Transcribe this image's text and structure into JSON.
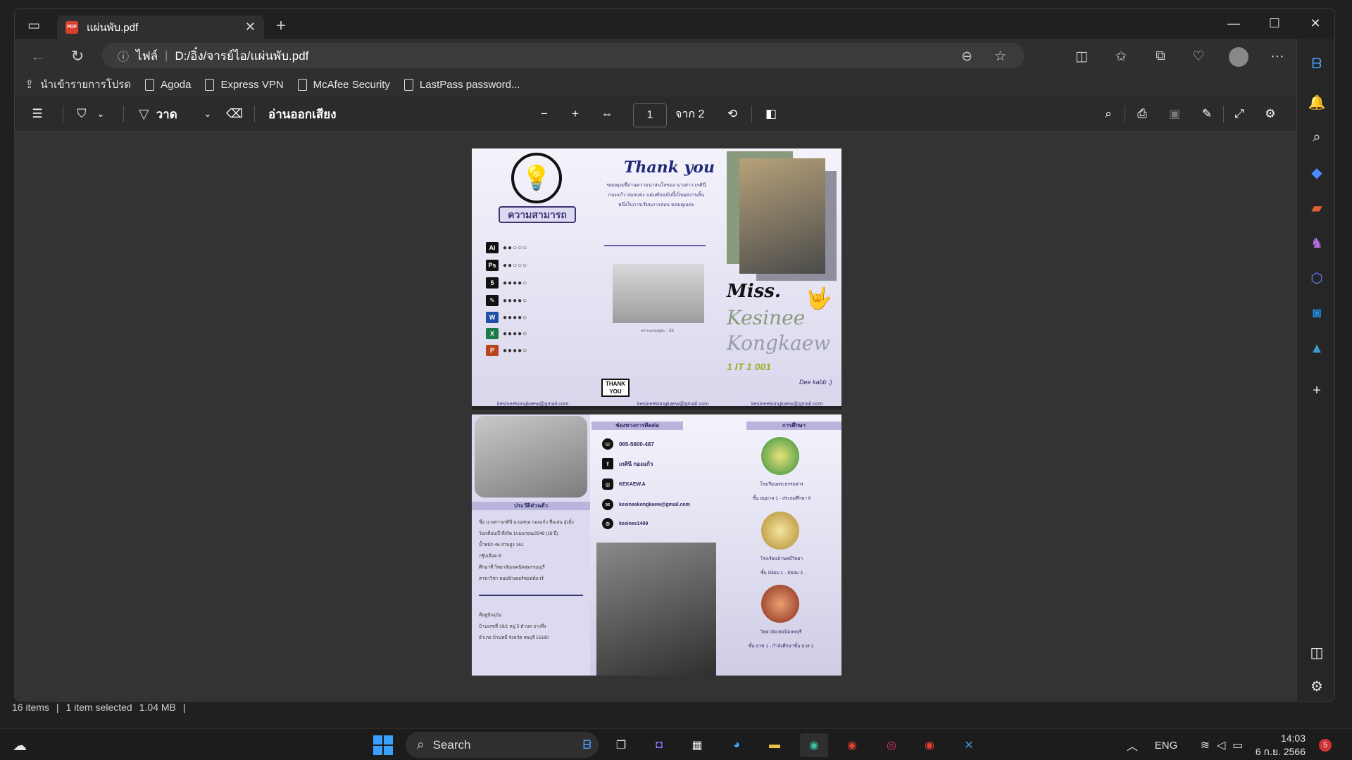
{
  "tab": {
    "title": "แผ่นพับ.pdf"
  },
  "address": {
    "scheme_label": "ไฟล์",
    "path": "D:/อิ๋ง/จารย์ไอ/แผ่นพับ.pdf"
  },
  "favorites": [
    {
      "label": "นำเข้ารายการโปรด"
    },
    {
      "label": "Agoda"
    },
    {
      "label": "Express VPN"
    },
    {
      "label": "McAfee Security"
    },
    {
      "label": "LastPass password..."
    }
  ],
  "pdf_toolbar": {
    "draw_label": "วาด",
    "read_aloud_label": "อ่านออกเสียง",
    "page_current": "1",
    "page_total_label": "จาก 2"
  },
  "page1": {
    "skills_title": "ความสามารถ",
    "skill_icons": [
      "Ai",
      "Ps",
      "5",
      "✎",
      "W",
      "X",
      "P"
    ],
    "thank_title": "Thank you",
    "thank_text": "ขอบคุณที่อ่านความน่าสนใจของ นางสาว เกศินี กองแก้ว จนจบค่ะ แผ่นพับฉบับนี้เป็นผลงานสิ้นหนึ่งในการเรียนการสอน ขอบคุณค่ะ",
    "photo_caption": "กราบงามๆค่ะ :-33",
    "sign_text": "THANK YOU",
    "name_prefix": "Miss.",
    "name_first": "Kesinee",
    "name_last": "Kongkaew",
    "class_code": "1 IT 1 001",
    "bye": "Dee kabb :)",
    "email": "kesineekongkaew@gmail.com"
  },
  "page2": {
    "bio_head": "ประวัติส่วนตัว",
    "bio_lines": [
      "ชื่อ นางสาวเกศินี นามสกุล กองแก้ว ชื่อเล่น อุ๋งอิ๋ง",
      "วัน/เดือน/ปี ที่เกิด 1/เมษายน/2548 (18 ปี)",
      "น้ำหนัก 46 ส่วนสูง 161",
      "กรุ๊ปเลือด B",
      "ศึกษาที่ วิทยาลัยเทคนิคสุพรรณบุรี",
      "สาขาวิชา คอมพิวเตอร์ซอฟต์แวร์"
    ],
    "address_lines": [
      "ที่อยู่ปัจจุบัน",
      "บ้านเลขที่ 16/1 หมู่ 5 ตำบล บางพึ่ง",
      "อำเภอ บ้านหมี่ จังหวัด ลพบุรี 15180"
    ],
    "contact_head": "ช่องทางการติดต่อ",
    "contacts": [
      "065-5600-487",
      "เกศินี กองแก้ว",
      "KEKAEW.A",
      "kesineekongkaew@gmail.com",
      "kesinee1409"
    ],
    "edu_head": "การศึกษา",
    "education": [
      {
        "school": "โรงเรียนพระธรรมสาร",
        "level": "ชั้น อนุบาล 1 - ประถมศึกษา 6"
      },
      {
        "school": "โรงเรียนบ้านหมี่วิทยา",
        "level": "ชั้น มัธยม 1 - มัธยม 3"
      },
      {
        "school": "วิทยาลัยเทคนิคลพบุรี",
        "level": "ชั้น ปวช 1 - กำลังศึกษาชั้น ปวส 1"
      }
    ]
  },
  "explorer_status": {
    "items": "16 items",
    "selected": "1 item selected",
    "size": "1.04 MB"
  },
  "taskbar": {
    "search_label": "Search",
    "lang": "ENG",
    "time": "14:03",
    "date": "6 ก.ย. 2566",
    "badge": "5"
  }
}
